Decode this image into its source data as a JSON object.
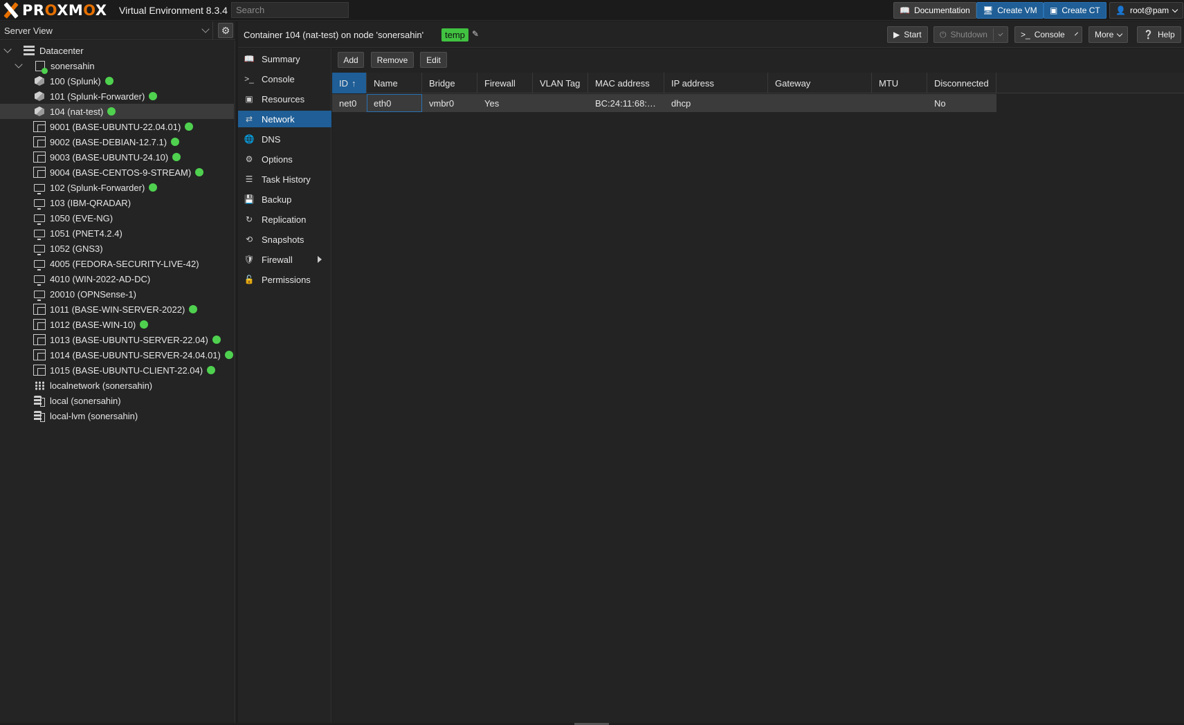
{
  "topbar": {
    "logo": "PROXMOX",
    "version": "Virtual Environment 8.3.4",
    "search_placeholder": "Search",
    "documentation": "Documentation",
    "create_vm": "Create VM",
    "create_ct": "Create CT",
    "user": "root@pam"
  },
  "tree": {
    "view": "Server View",
    "datacenter": "Datacenter",
    "node": "sonersahin",
    "items": [
      {
        "label": "100 (Splunk)",
        "type": "ct",
        "running": true
      },
      {
        "label": "101 (Splunk-Forwarder)",
        "type": "ct",
        "running": true
      },
      {
        "label": "104 (nat-test)",
        "type": "ct",
        "running": true,
        "selected": true
      },
      {
        "label": "9001 (BASE-UBUNTU-22.04.01)",
        "type": "ct-template",
        "running": true
      },
      {
        "label": "9002 (BASE-DEBIAN-12.7.1)",
        "type": "ct-template",
        "running": true
      },
      {
        "label": "9003 (BASE-UBUNTU-24.10)",
        "type": "ct-template",
        "running": true
      },
      {
        "label": "9004 (BASE-CENTOS-9-STREAM)",
        "type": "ct-template",
        "running": true
      },
      {
        "label": "102 (Splunk-Forwarder)",
        "type": "vm",
        "running": true
      },
      {
        "label": "103 (IBM-QRADAR)",
        "type": "vm",
        "running": false
      },
      {
        "label": "1050 (EVE-NG)",
        "type": "vm",
        "running": false
      },
      {
        "label": "1051 (PNET4.2.4)",
        "type": "vm",
        "running": false
      },
      {
        "label": "1052 (GNS3)",
        "type": "vm",
        "running": false
      },
      {
        "label": "4005 (FEDORA-SECURITY-LIVE-42)",
        "type": "vm",
        "running": false
      },
      {
        "label": "4010 (WIN-2022-AD-DC)",
        "type": "vm",
        "running": false
      },
      {
        "label": "20010 (OPNSense-1)",
        "type": "vm",
        "running": false
      },
      {
        "label": "1011 (BASE-WIN-SERVER-2022)",
        "type": "vm-template",
        "running": true
      },
      {
        "label": "1012 (BASE-WIN-10)",
        "type": "vm-template",
        "running": true
      },
      {
        "label": "1013 (BASE-UBUNTU-SERVER-22.04)",
        "type": "vm-template",
        "running": true
      },
      {
        "label": "1014 (BASE-UBUNTU-SERVER-24.04.01)",
        "type": "vm-template",
        "running": true
      },
      {
        "label": "1015 (BASE-UBUNTU-CLIENT-22.04)",
        "type": "vm-template",
        "running": true
      },
      {
        "label": "localnetwork (sonersahin)",
        "type": "network",
        "running": false
      },
      {
        "label": "local (sonersahin)",
        "type": "storage",
        "running": false
      },
      {
        "label": "local-lvm (sonersahin)",
        "type": "storage",
        "running": false
      }
    ]
  },
  "header": {
    "title": "Container 104 (nat-test) on node 'sonersahin'",
    "tag": "temp",
    "start": "Start",
    "shutdown": "Shutdown",
    "console": "Console",
    "more": "More",
    "help": "Help"
  },
  "subnav": {
    "items": [
      "Summary",
      "Console",
      "Resources",
      "Network",
      "DNS",
      "Options",
      "Task History",
      "Backup",
      "Replication",
      "Snapshots",
      "Firewall",
      "Permissions"
    ],
    "active": "Network"
  },
  "toolbar": {
    "add": "Add",
    "remove": "Remove",
    "edit": "Edit"
  },
  "grid": {
    "columns": [
      "ID",
      "Name",
      "Bridge",
      "Firewall",
      "VLAN Tag",
      "MAC address",
      "IP address",
      "Gateway",
      "MTU",
      "Disconnected"
    ],
    "sort_column": "ID",
    "rows": [
      {
        "ID": "net0",
        "Name": "eth0",
        "Bridge": "vmbr0",
        "Firewall": "Yes",
        "VLAN Tag": "",
        "MAC address": "BC:24:11:68:…",
        "IP address": "dhcp",
        "Gateway": "",
        "MTU": "",
        "Disconnected": "No"
      }
    ]
  },
  "colors": {
    "accent": "#1f5e96",
    "running": "#4fd14f",
    "tag": "#41c241",
    "logo_orange": "#e57000"
  }
}
